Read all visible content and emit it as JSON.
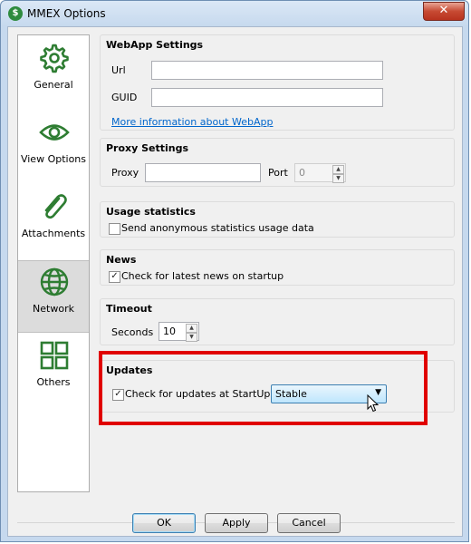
{
  "window": {
    "title": "MMEX Options",
    "app_icon": "$",
    "close_glyph": "✕"
  },
  "sidebar": {
    "items": [
      {
        "label": "General",
        "icon": "gear-icon"
      },
      {
        "label": "View Options",
        "icon": "eye-icon"
      },
      {
        "label": "Attachments",
        "icon": "paperclip-icon"
      },
      {
        "label": "Network",
        "icon": "globe-icon",
        "selected": true
      },
      {
        "label": "Others",
        "icon": "grid-icon"
      }
    ]
  },
  "webapp": {
    "title": "WebApp Settings",
    "url_label": "Url",
    "url_value": "",
    "guid_label": "GUID",
    "guid_value": "",
    "info_link": "More information about WebApp"
  },
  "proxy": {
    "title": "Proxy Settings",
    "proxy_label": "Proxy",
    "proxy_value": "",
    "port_label": "Port",
    "port_value": "0"
  },
  "usage": {
    "title": "Usage statistics",
    "checkbox_label": "Send anonymous statistics usage data",
    "checked": false
  },
  "news": {
    "title": "News",
    "checkbox_label": "Check for latest news on startup",
    "checked": true
  },
  "timeout": {
    "title": "Timeout",
    "seconds_label": "Seconds",
    "seconds_value": "10"
  },
  "updates": {
    "title": "Updates",
    "checkbox_label": "Check for updates at StartUp",
    "checked": true,
    "channel_value": "Stable"
  },
  "buttons": {
    "ok": "OK",
    "apply": "Apply",
    "cancel": "Cancel"
  },
  "glyphs": {
    "check": "✓",
    "up": "▲",
    "down": "▼",
    "caret": "▼"
  },
  "colors": {
    "accent_green": "#2e7d32",
    "highlight_red": "#e00000",
    "link_blue": "#0066cc"
  }
}
